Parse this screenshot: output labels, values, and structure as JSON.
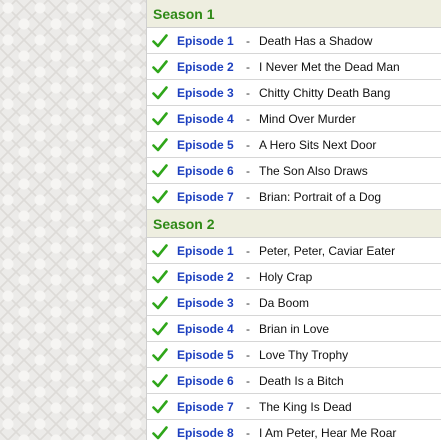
{
  "seasons": [
    {
      "title": "Season 1",
      "episodes": [
        {
          "label": "Episode 1",
          "title": "Death Has a Shadow"
        },
        {
          "label": "Episode 2",
          "title": "I Never Met the Dead Man"
        },
        {
          "label": "Episode 3",
          "title": "Chitty Chitty Death Bang"
        },
        {
          "label": "Episode 4",
          "title": "Mind Over Murder"
        },
        {
          "label": "Episode 5",
          "title": "A Hero Sits Next Door"
        },
        {
          "label": "Episode 6",
          "title": "The Son Also Draws"
        },
        {
          "label": "Episode 7",
          "title": "Brian: Portrait of a Dog"
        }
      ]
    },
    {
      "title": "Season 2",
      "episodes": [
        {
          "label": "Episode 1",
          "title": "Peter, Peter, Caviar Eater"
        },
        {
          "label": "Episode 2",
          "title": "Holy Crap"
        },
        {
          "label": "Episode 3",
          "title": "Da Boom"
        },
        {
          "label": "Episode 4",
          "title": "Brian in Love"
        },
        {
          "label": "Episode 5",
          "title": "Love Thy Trophy"
        },
        {
          "label": "Episode 6",
          "title": "Death Is a Bitch"
        },
        {
          "label": "Episode 7",
          "title": "The King Is Dead"
        },
        {
          "label": "Episode 8",
          "title": "I Am Peter, Hear Me Roar"
        }
      ]
    }
  ],
  "separator": "-",
  "icons": {
    "watched": "check-mark-icon"
  },
  "colors": {
    "season_header_text": "#2f8a17",
    "season_header_bg": "#eeeee0",
    "episode_link": "#1c3fbf",
    "check_mark": "#2fa61a"
  }
}
